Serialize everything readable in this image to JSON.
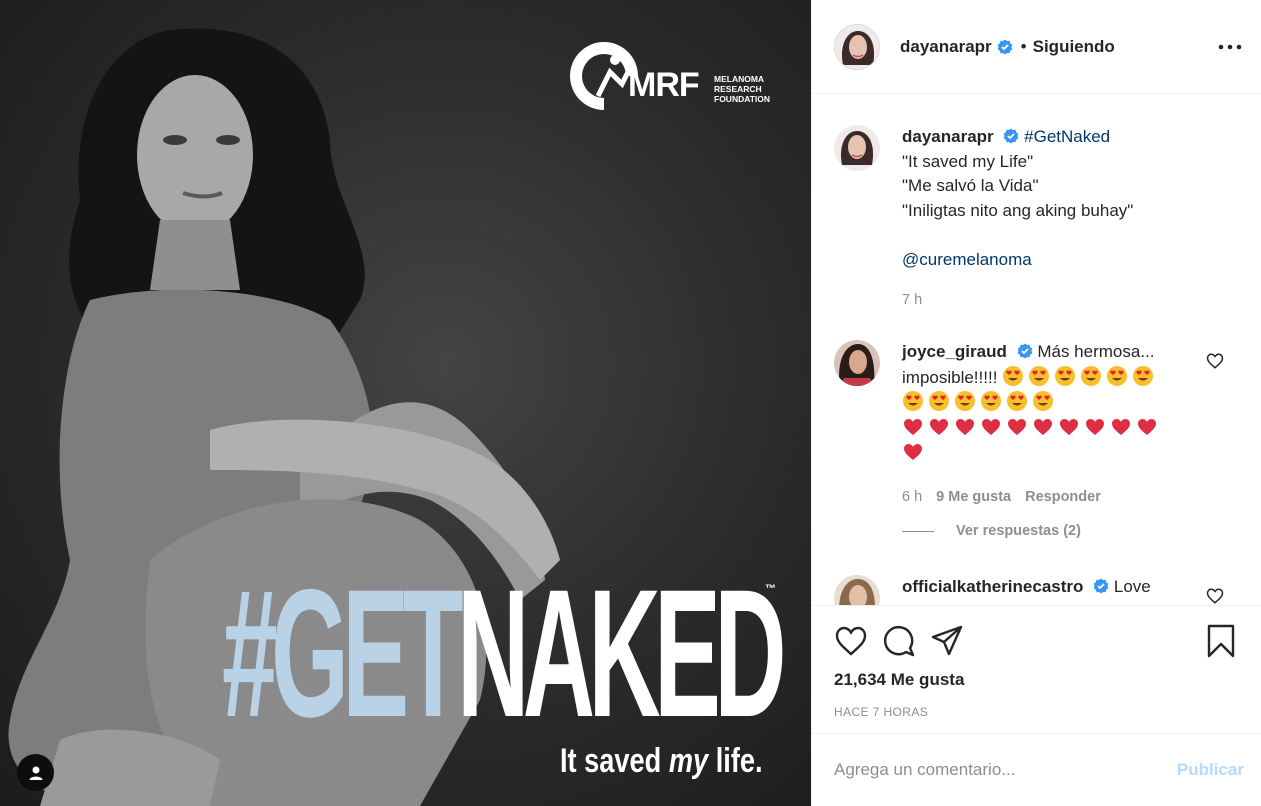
{
  "media": {
    "logo_abbr": "MRF",
    "logo_sub_lines": [
      "MELANOMA",
      "RESEARCH",
      "FOUNDATION"
    ],
    "headline_hash": "#GET",
    "headline_word": "NAKED",
    "trademark": "™",
    "tagline_start": "It saved ",
    "tagline_em": "my",
    "tagline_end": " life.",
    "tag_icon": "user-icon"
  },
  "header": {
    "username": "dayanarapr",
    "separator": "•",
    "follow_status": "Siguiendo",
    "more_icon": "more-horizontal-icon"
  },
  "caption": {
    "username": "dayanarapr",
    "hashtag": "#GetNaked",
    "lines": [
      "\"It saved my Life\"",
      "\"Me salvó la Vida\"",
      "\"Iniligtas nito ang aking buhay\""
    ],
    "mention": "@curemelanoma",
    "time": "7 h"
  },
  "comments": [
    {
      "username": "joyce_giraud",
      "text": "Más hermosa... imposible!!!!!",
      "emoji_heart_eyes_count": 12,
      "emoji_red_heart_count": 11,
      "time": "6 h",
      "likes": "9 Me gusta",
      "reply": "Responder",
      "view_replies": "Ver respuestas (2)"
    },
    {
      "username": "officialkatherinecastro",
      "text": "Love"
    }
  ],
  "actions": {
    "like_icon": "heart-icon",
    "comment_icon": "comment-icon",
    "share_icon": "paper-plane-icon",
    "save_icon": "bookmark-icon",
    "likes_count": "21,634 Me gusta",
    "time_ago": "HACE 7 HORAS"
  },
  "add_comment": {
    "placeholder": "Agrega un comentario...",
    "post_label": "Publicar"
  },
  "colors": {
    "link": "#00376b",
    "muted": "#8e8e8e",
    "verified": "#3897f0",
    "post_disabled": "#b3dbff",
    "headline_blue": "#b9d2e6"
  }
}
